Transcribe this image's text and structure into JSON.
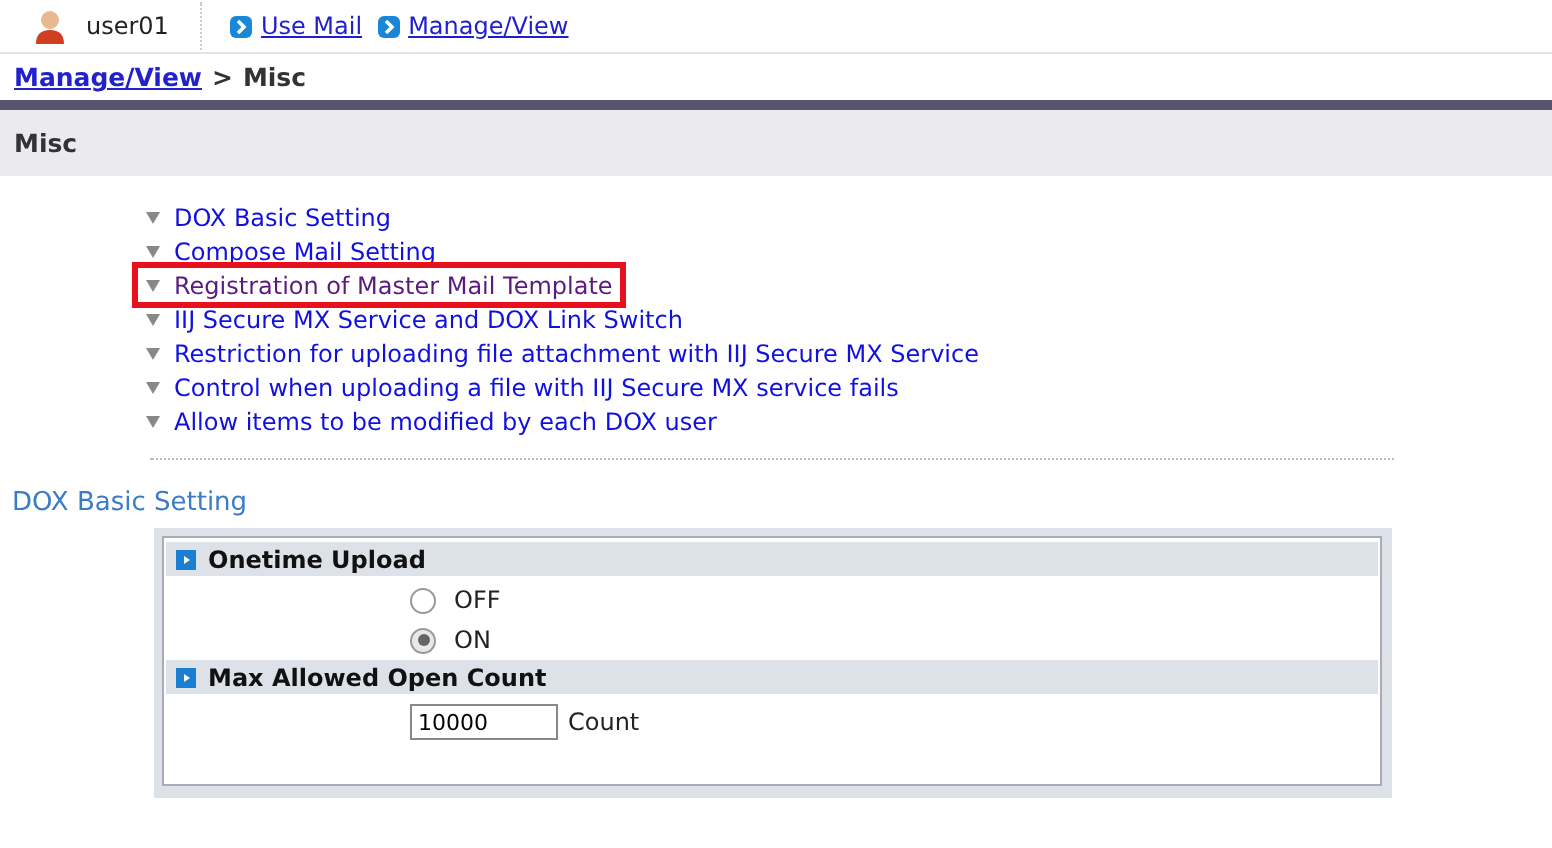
{
  "header": {
    "user": "user01",
    "links": [
      "Use Mail",
      "Manage/View"
    ]
  },
  "breadcrumb": {
    "parent": "Manage/View",
    "separator": ">",
    "current": "Misc"
  },
  "page_title": "Misc",
  "menu": [
    {
      "label": "DOX Basic Setting",
      "visited": false,
      "highlighted": false
    },
    {
      "label": "Compose Mail Setting",
      "visited": false,
      "highlighted": false
    },
    {
      "label": "Registration of Master Mail Template",
      "visited": true,
      "highlighted": true
    },
    {
      "label": "IIJ Secure MX Service and DOX Link Switch",
      "visited": false,
      "highlighted": false
    },
    {
      "label": "Restriction for uploading file attachment with IIJ Secure MX Service",
      "visited": false,
      "highlighted": false
    },
    {
      "label": "Control when uploading a file with IIJ Secure MX service fails",
      "visited": false,
      "highlighted": false
    },
    {
      "label": "Allow items to be modified by each DOX user",
      "visited": false,
      "highlighted": false
    }
  ],
  "section_title": "DOX Basic Setting",
  "settings": [
    {
      "kind": "radio",
      "title": "Onetime Upload",
      "options": [
        {
          "label": "OFF",
          "selected": false
        },
        {
          "label": "ON",
          "selected": true
        }
      ]
    },
    {
      "kind": "number",
      "title": "Max Allowed Open Count",
      "value": "10000",
      "unit": "Count"
    }
  ]
}
